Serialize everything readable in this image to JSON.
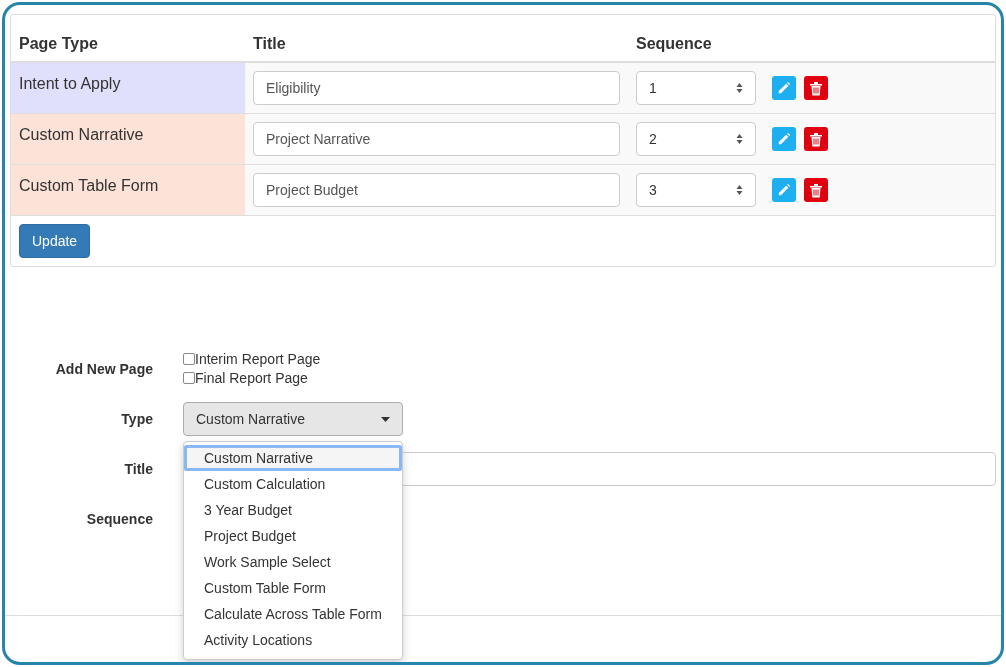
{
  "table": {
    "columns": [
      "Page Type",
      "Title",
      "Sequence"
    ],
    "rows": [
      {
        "page_type": "Intent to Apply",
        "color": "#e0e0fc",
        "title": "Eligibility",
        "sequence": "1"
      },
      {
        "page_type": "Custom Narrative",
        "color": "#fde2d8",
        "title": "Project Narrative",
        "sequence": "2"
      },
      {
        "page_type": "Custom Table Form",
        "color": "#fde2d8",
        "title": "Project Budget",
        "sequence": "3"
      }
    ],
    "update_button": "Update"
  },
  "form": {
    "add_label": "Add New Page",
    "checkboxes": [
      {
        "label": "Interim Report Page",
        "checked": false
      },
      {
        "label": "Final Report Page",
        "checked": false
      }
    ],
    "type_label": "Type",
    "type_value": "Custom Narrative",
    "type_options": [
      {
        "label": "Custom Narrative",
        "selected": true
      },
      {
        "label": "Custom Calculation",
        "selected": false
      },
      {
        "label": "3 Year Budget",
        "selected": false
      },
      {
        "label": "Project Budget",
        "selected": false
      },
      {
        "label": "Work Sample Select",
        "selected": false
      },
      {
        "label": "Custom Table Form",
        "selected": false
      },
      {
        "label": "Calculate Across Table Form",
        "selected": false
      },
      {
        "label": "Activity Locations",
        "selected": false
      }
    ],
    "title_label": "Title",
    "sequence_label": "Sequence"
  }
}
